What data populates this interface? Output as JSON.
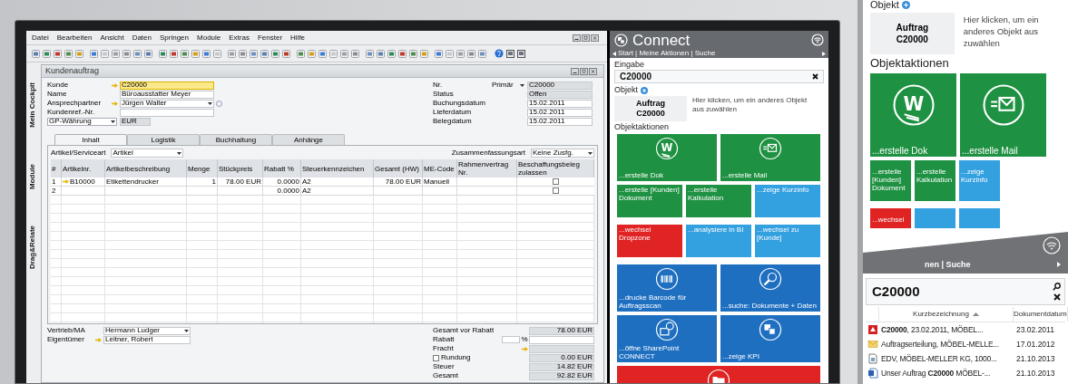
{
  "menu": [
    "Datei",
    "Bearbeiten",
    "Ansicht",
    "Daten",
    "Springen",
    "Module",
    "Extras",
    "Fenster",
    "Hilfe"
  ],
  "sidebar_tabs": [
    "Mein Cockpit",
    "Module",
    "Drag&Relate"
  ],
  "form": {
    "title": "Kundenauftrag",
    "left_fields": [
      {
        "label": "Kunde",
        "value": "C20000",
        "kind": "link",
        "focused": true
      },
      {
        "label": "Name",
        "value": "Büroausstatter Meyer",
        "kind": "text",
        "focused": false
      },
      {
        "label": "Ansprechpartner",
        "value": "Jürgen Walter",
        "kind": "link_dropdown",
        "focused": false
      },
      {
        "label": "Kundenref.-Nr.",
        "kind": "text",
        "focused": false
      },
      {
        "label": "GP-Währung",
        "value": "EUR",
        "kind": "label_dropdown",
        "focused": false
      }
    ],
    "right_fields": [
      {
        "label": "Nr.",
        "series": "Primär",
        "value": "C20000",
        "readonly": true
      },
      {
        "label": "Status",
        "value": "Offen",
        "readonly": true
      },
      {
        "label": "Buchungsdatum",
        "value": "15.02.2011",
        "readonly": false
      },
      {
        "label": "Lieferdatum",
        "value": "15.02.2011",
        "readonly": false
      },
      {
        "label": "Belegdatum",
        "value": "15.02.2011",
        "readonly": false
      }
    ],
    "tabs": [
      {
        "label": "Inhalt",
        "selected": true
      },
      {
        "label": "Logistik",
        "selected": false
      },
      {
        "label": "Buchhaltung",
        "selected": false
      },
      {
        "label": "Anhänge",
        "selected": false
      }
    ],
    "item_type": {
      "label": "Artikel/Serviceart",
      "value": "Artikel"
    },
    "summary_type": {
      "label": "Zusammenfassungsart",
      "value": "Keine Zusfg."
    },
    "table": {
      "columns": [
        "#",
        "Artikelnr.",
        "Artikelbeschreibung",
        "Menge",
        "Stückpreis",
        "Rabatt %",
        "Steuerkennzeichen",
        "Gesamt (HW)",
        "ME-Code",
        "Rahmenvertrag Nr.",
        "Beschaffungsbeleg zulassen"
      ],
      "rows": [
        {
          "number": "1",
          "item_no": "B10000",
          "description": "Etikettendrucker",
          "quantity": "1",
          "unit_price": "78.00 EUR",
          "discount": "0.0000",
          "tax_code": "A2",
          "total": "78.00 EUR",
          "uom_code": "Manuell",
          "allow_procurement": false
        },
        {
          "number": "2",
          "discount": "0.0000",
          "tax_code": "A2",
          "allow_procurement": false
        }
      ]
    },
    "bottom_fields": [
      {
        "label": "Vertrieb/MA",
        "value": "Hermann Ludger",
        "kind": "dropdown"
      },
      {
        "label": "Eigentümer",
        "value": "Leitner, Robert",
        "kind": "link"
      }
    ],
    "totals": [
      {
        "label": "Gesamt vor Rabatt",
        "value": "78.00 EUR",
        "kind": "amount"
      },
      {
        "label": "Rabatt",
        "unit": "%",
        "kind": "percent"
      },
      {
        "label": "Fracht",
        "kind": "link"
      },
      {
        "label": "Rundung",
        "value": "0.00 EUR",
        "kind": "checkbox",
        "checked": false
      },
      {
        "label": "Steuer",
        "value": "14.82 EUR",
        "kind": "amount"
      },
      {
        "label": "Gesamt",
        "value": "92.82 EUR",
        "kind": "amount"
      }
    ]
  },
  "connect": {
    "title": "Connect",
    "breadcrumb": "Start | Meine Aktionen | Suche",
    "input_label": "Eingabe",
    "input_value": "C20000",
    "object_label": "Objekt",
    "object": {
      "type": "Auftrag",
      "number": "C20000"
    },
    "object_hint": "Hier klicken, um ein anderes Objekt aus zuwählen",
    "actions_label": "Objektaktionen",
    "tiles": [
      {
        "kind": "large",
        "label": "...erstelle Dok",
        "color": "#1f9142",
        "glyph": "W"
      },
      {
        "kind": "large",
        "label": "...erstelle Mail",
        "color": "#1f9142"
      },
      {
        "kind": "small",
        "label": "...erstelle [Kunden] Dokument",
        "color": "#1f9142"
      },
      {
        "kind": "small",
        "label": "...erstelle Kalkulation",
        "color": "#1f9142"
      },
      {
        "kind": "small",
        "label": "...zeige Kurzinfo",
        "color": "#33a0e0"
      },
      {
        "kind": "small",
        "label": "...wechsel Dropzone",
        "color": "#e02323"
      },
      {
        "kind": "small",
        "label": "...analysiere in BI",
        "color": "#33a0e0"
      },
      {
        "kind": "small",
        "label": "...wechsel zu [Kunde]",
        "color": "#33a0e0"
      },
      {
        "kind": "large",
        "label": "...drucke Barcode für Auftragsscan",
        "color": "#1f6fc1"
      },
      {
        "kind": "large",
        "label": "...suche: Dokumente + Daten",
        "color": "#1f6fc1"
      },
      {
        "kind": "large",
        "label": "...öffne SharePoint CONNECT",
        "color": "#1f6fc1"
      },
      {
        "kind": "large",
        "label": "...zeige KPI",
        "color": "#1f6fc1"
      },
      {
        "kind": "wide",
        "color": "#e02323"
      }
    ]
  },
  "zoom_panel": {
    "object_label": "Objekt",
    "object": {
      "type": "Auftrag",
      "number": "C20000"
    },
    "object_hint": "Hier klicken, um ein anderes Objekt aus zuwählen",
    "actions_label": "Objektaktionen",
    "tiles": [
      {
        "kind": "large",
        "label": "...erstelle Dok",
        "color": "#1f9142",
        "glyph": "W"
      },
      {
        "kind": "large",
        "label": "...erstelle Mail",
        "color": "#1f9142"
      },
      {
        "kind": "small",
        "label": "...erstelle [Kunden] Dokument",
        "color": "#1f9142"
      },
      {
        "kind": "small",
        "label": "...erstelle Kalkulation",
        "color": "#1f9142"
      },
      {
        "kind": "small",
        "label": "...zeige Kurzinfo",
        "color": "#33a0e0"
      },
      {
        "kind": "small",
        "label": "...wechsel",
        "color": "#e02323"
      },
      {
        "kind": "small",
        "color": "#33a0e0"
      },
      {
        "kind": "small",
        "color": "#33a0e0"
      }
    ],
    "breadcrumb_fragment": "nen | Suche",
    "search_value": "C20000",
    "columns": [
      {
        "label": "Kurzbezeichnung",
        "sorted": true
      },
      {
        "label": "Dokumentdatum",
        "sorted": false
      }
    ],
    "results": [
      {
        "kind": "pdf",
        "title": "**C20000**, 23.02.2011, MÖBEL...",
        "date": "23.02.2011"
      },
      {
        "kind": "mail",
        "title": "Auftragserteilung, MÖBEL-MELLE...",
        "date": "17.01.2012"
      },
      {
        "kind": "document",
        "title": "EDV, MÖBEL-MELLER KG, 1000...",
        "date": "21.10.2013"
      },
      {
        "kind": "word",
        "title": "Unser Auftrag **C20000** MÖBEL-...",
        "date": "21.10.2013"
      }
    ]
  }
}
